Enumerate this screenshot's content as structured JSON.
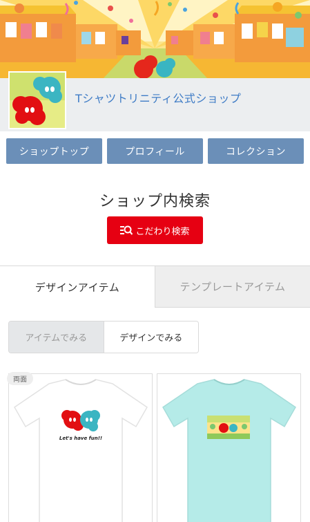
{
  "shop": {
    "name": "Tシャツトリニティ公式ショップ",
    "accent_color": "#3f7cc6"
  },
  "nav": {
    "items": [
      {
        "label": "ショップトップ"
      },
      {
        "label": "プロフィール"
      },
      {
        "label": "コレクション"
      }
    ],
    "color": "#6b8fb8"
  },
  "search": {
    "title": "ショップ内検索",
    "button_label": "こだわり検索",
    "button_color": "#e60012",
    "button_icon": "filter-search-icon"
  },
  "tabs": [
    {
      "label": "デザインアイテム",
      "active": true
    },
    {
      "label": "テンプレートアイテム",
      "active": false
    }
  ],
  "view_toggle": {
    "options": [
      {
        "label": "アイテムでみる",
        "selected": true
      },
      {
        "label": "デザインでみる",
        "selected": false
      }
    ]
  },
  "products": [
    {
      "badge": "両面",
      "shirt_color": "#ffffff",
      "print_text": "Let's have fun!!"
    },
    {
      "shirt_color": "#b5ebe8"
    }
  ]
}
